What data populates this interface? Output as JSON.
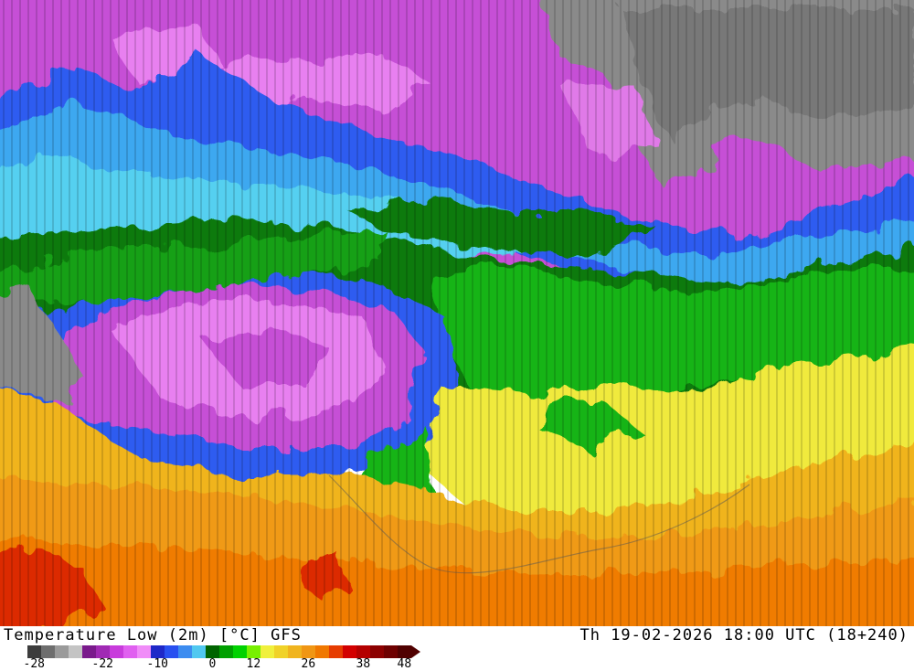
{
  "title_left": "Temperature Low (2m) [°C] GFS",
  "title_right": "Th 19-02-2026 18:00 UTC (18+240)",
  "colorbar": {
    "colors": [
      "#3c3c3c",
      "#6e6e6e",
      "#9a9a9a",
      "#c4c4c4",
      "#7a1a8c",
      "#a02ab4",
      "#c83cdc",
      "#e060f0",
      "#f08cf8",
      "#1e28c8",
      "#2850f0",
      "#3c8cf0",
      "#50c8f0",
      "#006400",
      "#00a000",
      "#00d200",
      "#78f000",
      "#f0f03c",
      "#f0d228",
      "#f0b41e",
      "#f09614",
      "#f07800",
      "#e63c00",
      "#d20000",
      "#b40000",
      "#8c0000",
      "#6e0000",
      "#500000"
    ],
    "labels": [
      {
        "text": "-28",
        "slot": 0
      },
      {
        "text": "-22",
        "slot": 5
      },
      {
        "text": "-10",
        "slot": 9
      },
      {
        "text": "0",
        "slot": 13
      },
      {
        "text": "12",
        "slot": 16
      },
      {
        "text": "26",
        "slot": 20
      },
      {
        "text": "38",
        "slot": 24
      },
      {
        "text": "48",
        "slot": 27
      }
    ]
  }
}
